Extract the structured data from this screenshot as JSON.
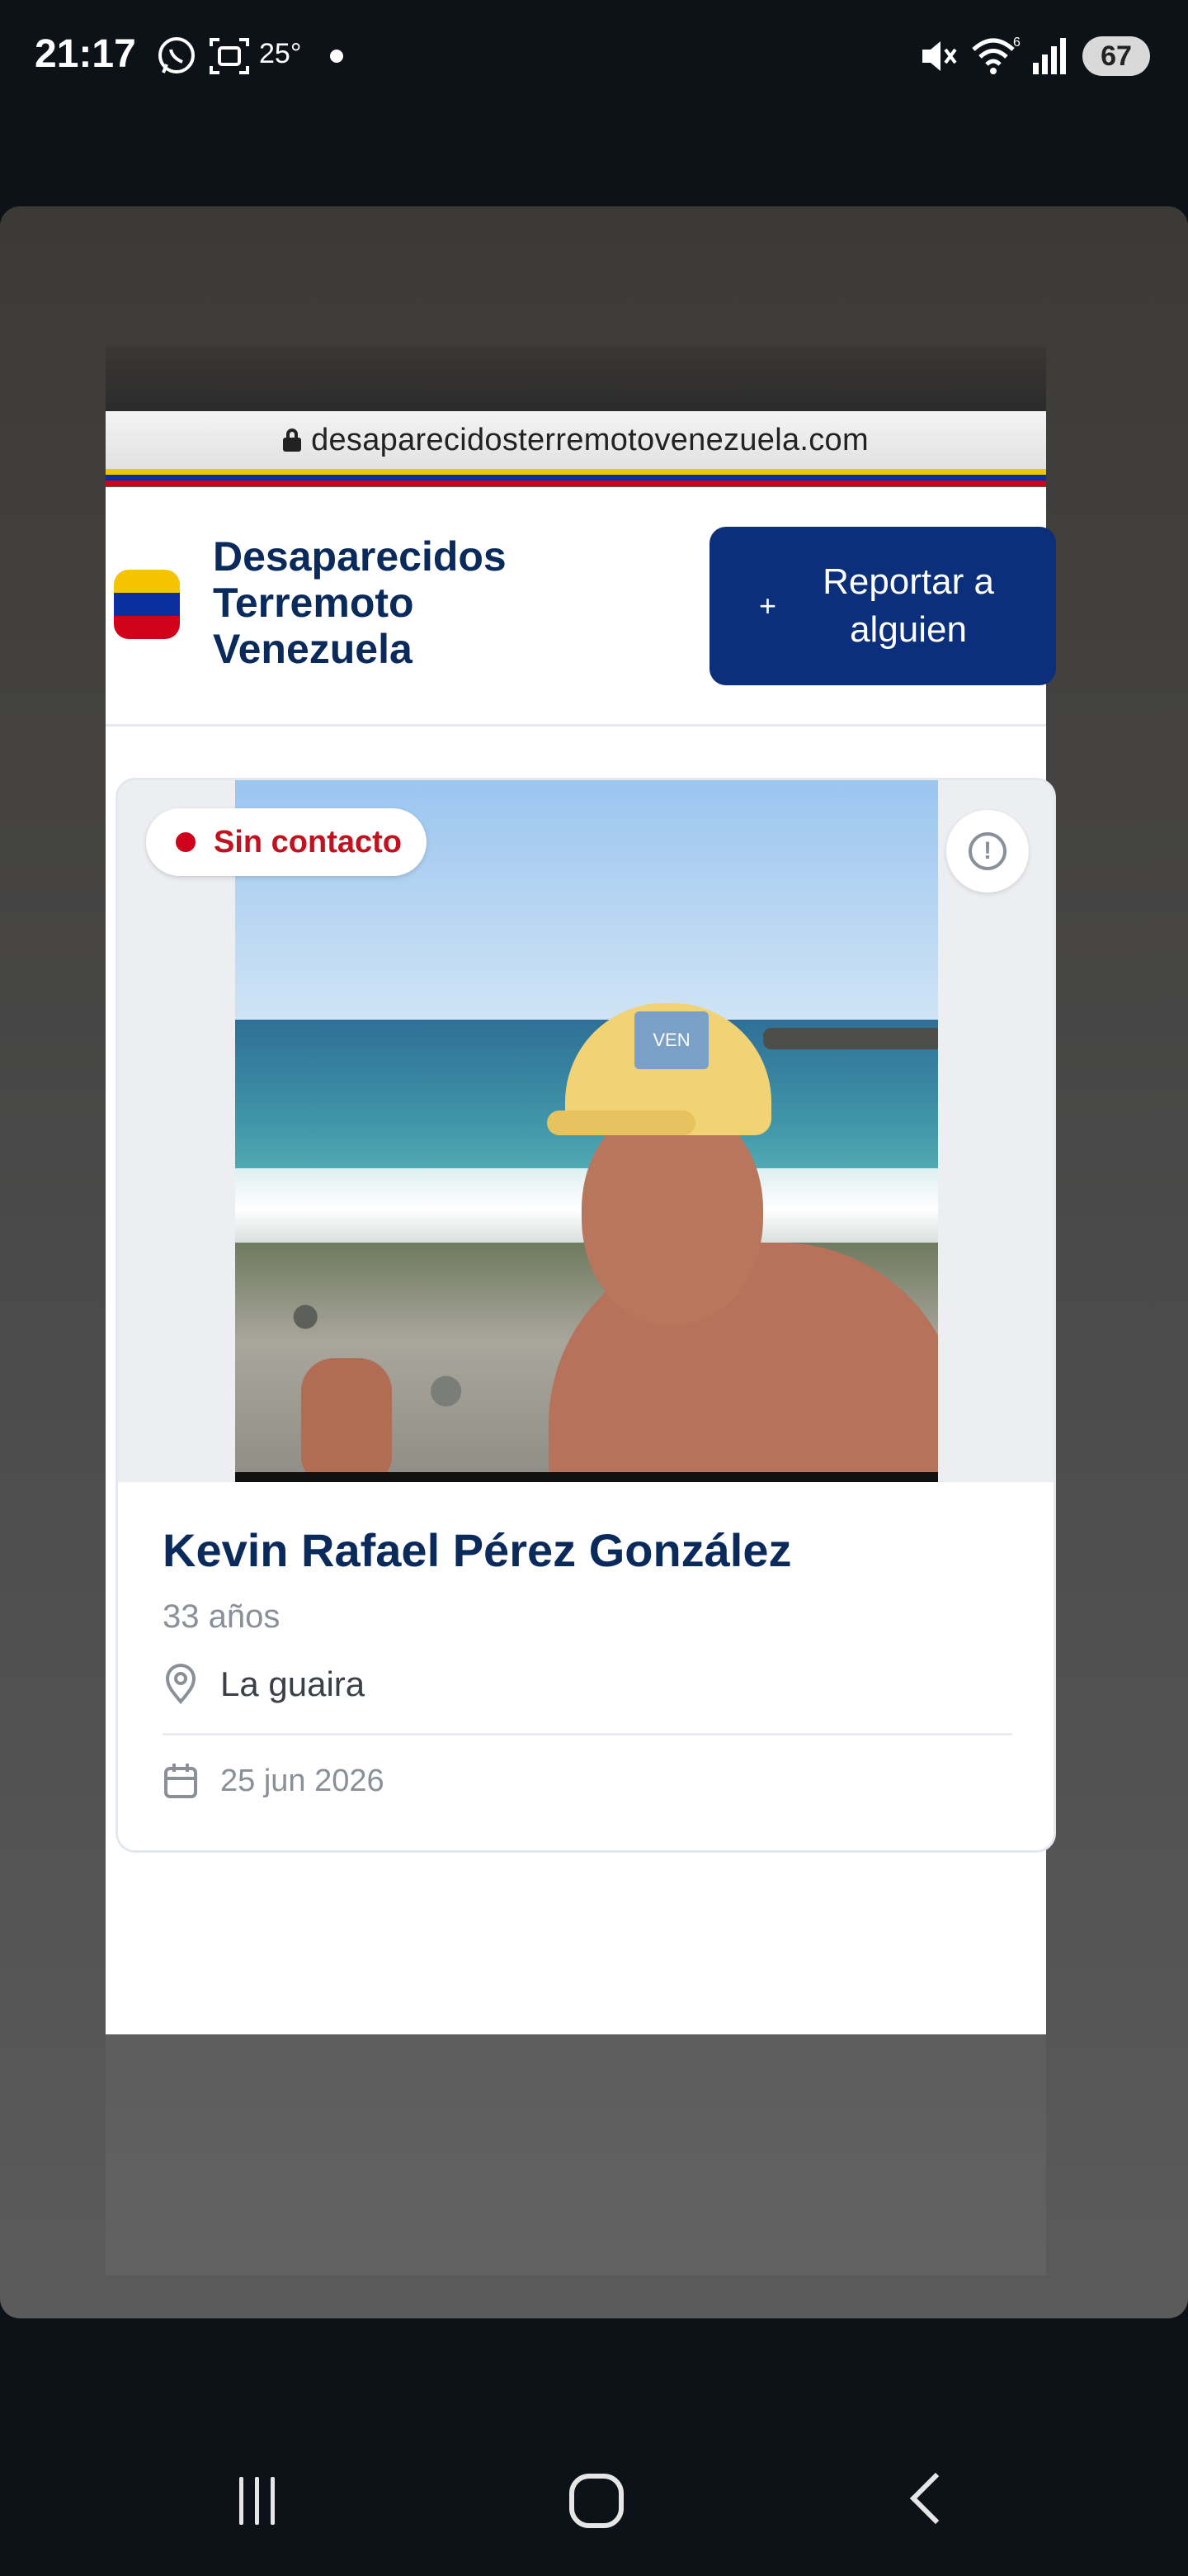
{
  "status_bar": {
    "time": "21:17",
    "temperature": "25°",
    "battery": "67",
    "wifi_badge": "6",
    "icons": [
      "whatsapp-icon",
      "screenshot-icon",
      "mute-icon",
      "wifi-icon",
      "signal-icon"
    ]
  },
  "browser": {
    "url": "desaparecidosterremotovenezuela.com"
  },
  "header": {
    "brand_line1": "Desaparecidos",
    "brand_line2": "Terremoto",
    "brand_line3": "Venezuela",
    "report_button_icon": "+",
    "report_button_label": "Reportar a alguien"
  },
  "card": {
    "status_label": "Sin contacto",
    "alert_icon": "!",
    "cap_text": "VEN",
    "name": "Kevin Rafael Pérez González",
    "age": "33 años",
    "location": "La guaira",
    "date": "25 jun 2026"
  },
  "colors": {
    "brand_navy": "#0b2f7a",
    "status_red": "#d0021b",
    "flag_yellow": "#f5c400",
    "flag_blue": "#0b2f9f",
    "flag_red": "#d0021b"
  }
}
